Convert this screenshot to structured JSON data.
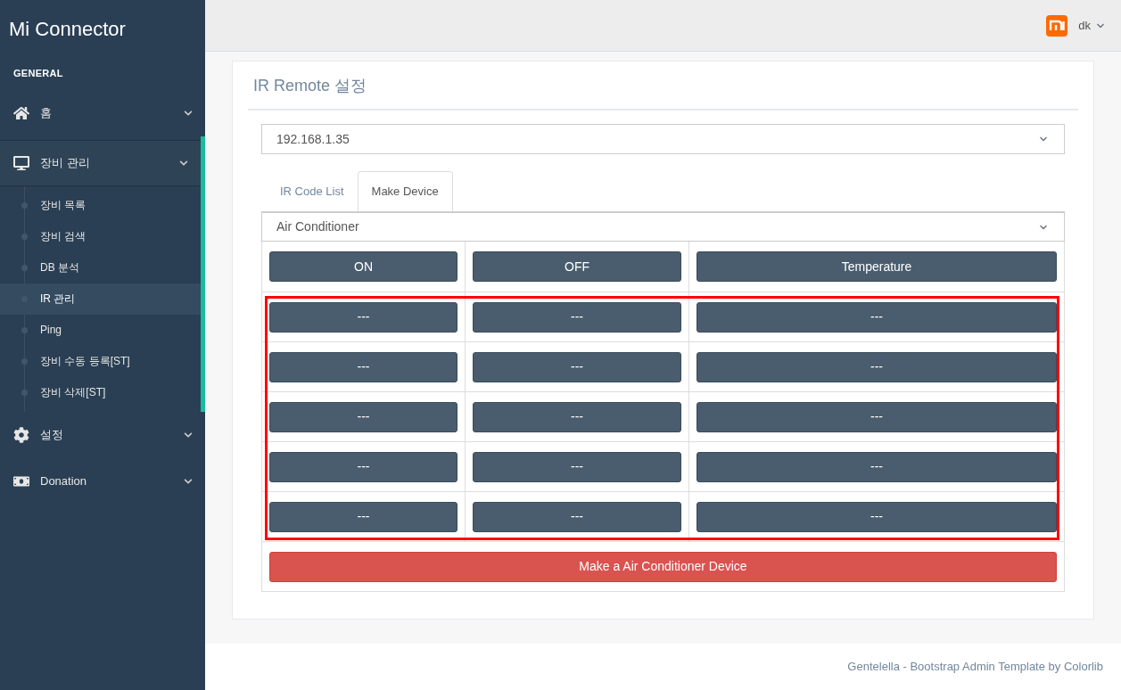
{
  "brand": "Mi Connector",
  "sidebar": {
    "section": "GENERAL",
    "items": [
      {
        "label": "홈",
        "kind": "home",
        "expanded": false
      },
      {
        "label": "장비 관리",
        "kind": "monitor",
        "expanded": true,
        "children": [
          {
            "label": "장비 목록",
            "selected": false
          },
          {
            "label": "장비 검색",
            "selected": false
          },
          {
            "label": "DB 분석",
            "selected": false
          },
          {
            "label": "IR 관리",
            "selected": true
          },
          {
            "label": "Ping",
            "selected": false
          },
          {
            "label": "장비 수동 등록[ST]",
            "selected": false
          },
          {
            "label": "장비 삭제[ST]",
            "selected": false
          }
        ]
      },
      {
        "label": "설정",
        "kind": "gear",
        "expanded": false
      },
      {
        "label": "Donation",
        "kind": "money",
        "expanded": false
      }
    ]
  },
  "topbar": {
    "user": "dk"
  },
  "panel": {
    "title": "IR Remote 설정",
    "device_select": "192.168.1.35",
    "tabs": [
      {
        "label": "IR Code List",
        "selected": false
      },
      {
        "label": "Make Device",
        "selected": true
      }
    ],
    "type_select": "Air Conditioner",
    "button_rows": [
      {
        "highlighted": false,
        "buttons": [
          "ON",
          "OFF",
          "Temperature"
        ]
      },
      {
        "highlighted": true,
        "buttons": [
          "---",
          "---",
          "---"
        ]
      },
      {
        "highlighted": true,
        "buttons": [
          "---",
          "---",
          "---"
        ]
      },
      {
        "highlighted": true,
        "buttons": [
          "---",
          "---",
          "---"
        ]
      },
      {
        "highlighted": true,
        "buttons": [
          "---",
          "---",
          "---"
        ]
      },
      {
        "highlighted": true,
        "buttons": [
          "---",
          "---",
          "---"
        ]
      }
    ],
    "make_button": "Make a Air Conditioner Device"
  },
  "footer": "Gentelella - Bootstrap Admin Template by Colorlib"
}
